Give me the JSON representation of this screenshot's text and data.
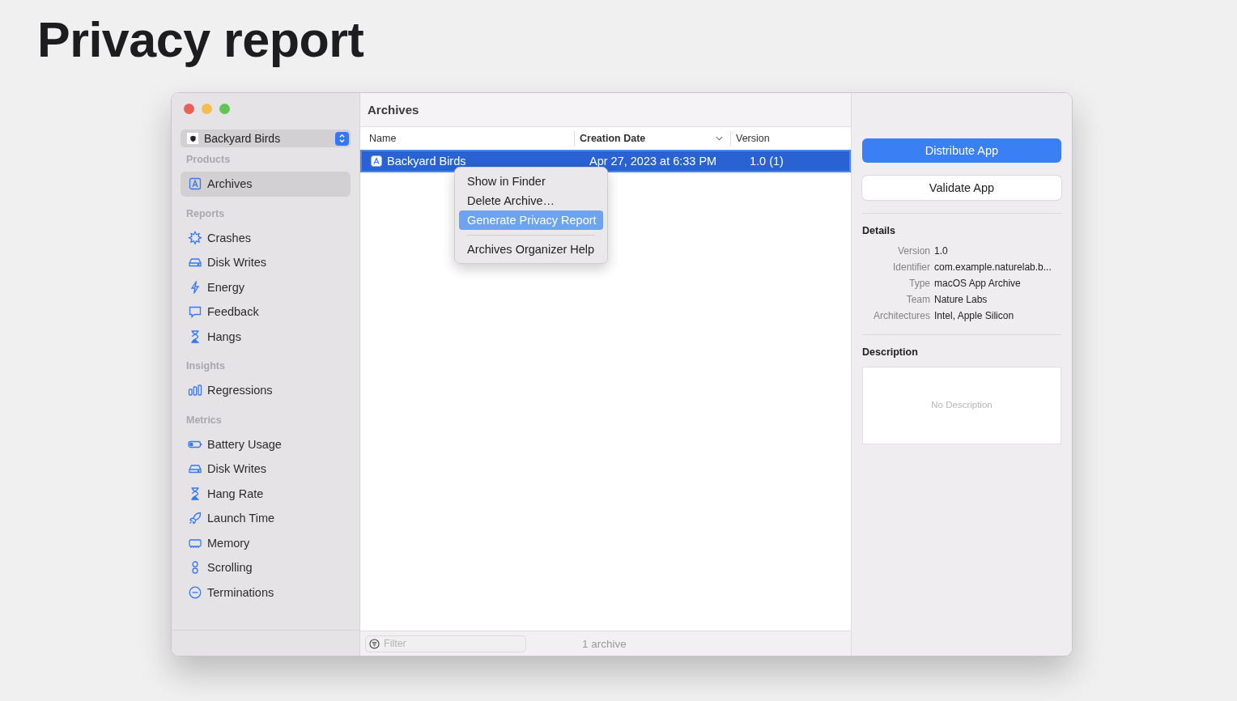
{
  "page_title": "Privacy report",
  "window": {
    "scheme_picker": {
      "value": "Backyard Birds"
    },
    "sidebar": [
      {
        "heading": "Products",
        "items": [
          {
            "label": "Archives",
            "kind": "archive",
            "selected": true
          }
        ]
      },
      {
        "heading": "Reports",
        "items": [
          {
            "label": "Crashes",
            "kind": "crash",
            "selected": false
          },
          {
            "label": "Disk Writes",
            "kind": "disk",
            "selected": false
          },
          {
            "label": "Energy",
            "kind": "bolt",
            "selected": false
          },
          {
            "label": "Feedback",
            "kind": "bubble",
            "selected": false
          },
          {
            "label": "Hangs",
            "kind": "hourglass",
            "selected": false
          }
        ]
      },
      {
        "heading": "Insights",
        "items": [
          {
            "label": "Regressions",
            "kind": "bars",
            "selected": false
          }
        ]
      },
      {
        "heading": "Metrics",
        "items": [
          {
            "label": "Battery Usage",
            "kind": "battery",
            "selected": false
          },
          {
            "label": "Disk Writes",
            "kind": "disk",
            "selected": false
          },
          {
            "label": "Hang Rate",
            "kind": "hourglass",
            "selected": false
          },
          {
            "label": "Launch Time",
            "kind": "rocket",
            "selected": false
          },
          {
            "label": "Memory",
            "kind": "chip",
            "selected": false
          },
          {
            "label": "Scrolling",
            "kind": "scroll",
            "selected": false
          },
          {
            "label": "Terminations",
            "kind": "minus",
            "selected": false
          }
        ]
      }
    ],
    "content_title": "Archives",
    "table": {
      "columns": [
        "Name",
        "Creation Date",
        "Version"
      ],
      "rows": [
        {
          "name": "Backyard Birds",
          "date": "Apr 27, 2023 at 6:33 PM",
          "version": "1.0 (1)",
          "selected": true
        }
      ]
    },
    "context_menu": [
      {
        "label": "Show in Finder",
        "kind": "item",
        "selected": false
      },
      {
        "label": "Delete Archive…",
        "kind": "item",
        "selected": false
      },
      {
        "label": "Generate Privacy Report",
        "kind": "item",
        "selected": true
      },
      {
        "kind": "separator"
      },
      {
        "label": "Archives Organizer Help",
        "kind": "item",
        "selected": false
      }
    ],
    "filter": {
      "placeholder": "Filter"
    },
    "archive_count": "1 archive",
    "buttons": [
      {
        "label": "Distribute App",
        "kind": "primary"
      },
      {
        "label": "Validate App",
        "kind": "secondary"
      }
    ],
    "details_title": "Details",
    "details": [
      {
        "label": "Version",
        "value": "1.0"
      },
      {
        "label": "Identifier",
        "value": "com.example.naturelab.b..."
      },
      {
        "label": "Type",
        "value": "macOS App Archive"
      },
      {
        "label": "Team",
        "value": "Nature Labs"
      },
      {
        "label": "Architectures",
        "value": "Intel, Apple Silicon"
      }
    ],
    "description_title": "Description",
    "description_placeholder": "No Description"
  }
}
